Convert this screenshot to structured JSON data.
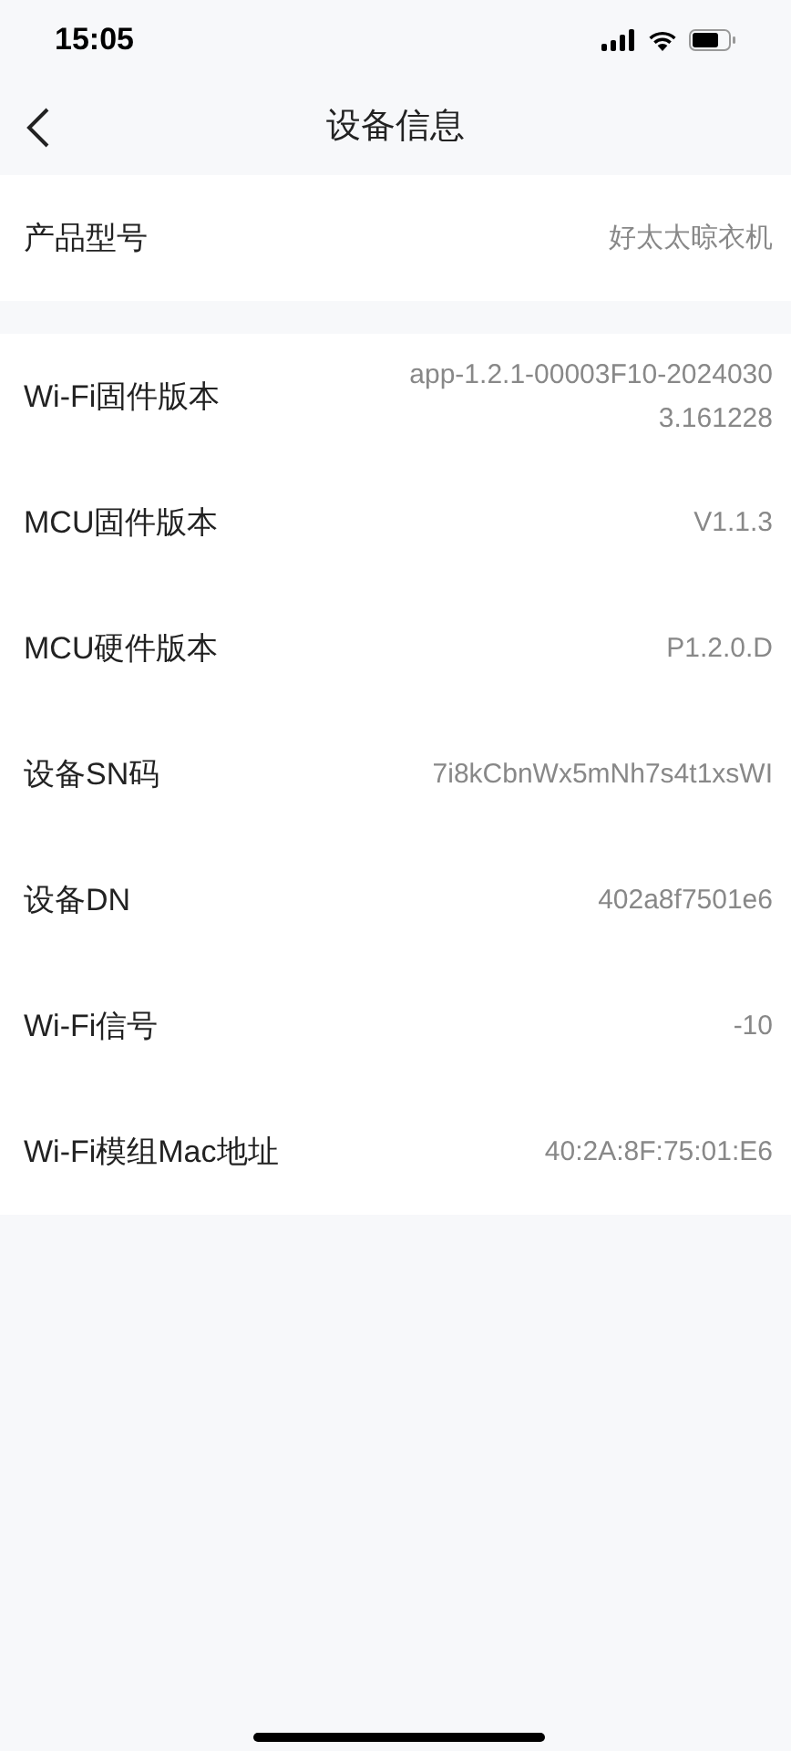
{
  "status_bar": {
    "time": "15:05"
  },
  "nav": {
    "title": "设备信息"
  },
  "groups": [
    {
      "rows": [
        {
          "label": "产品型号",
          "value": "好太太晾衣机"
        }
      ]
    },
    {
      "rows": [
        {
          "label": "Wi-Fi固件版本",
          "value": "app-1.2.1-00003F10-20240303.161228"
        },
        {
          "label": "MCU固件版本",
          "value": "V1.1.3"
        },
        {
          "label": "MCU硬件版本",
          "value": "P1.2.0.D"
        },
        {
          "label": "设备SN码",
          "value": "7i8kCbnWx5mNh7s4t1xsWI"
        },
        {
          "label": "设备DN",
          "value": "402a8f7501e6"
        },
        {
          "label": "Wi-Fi信号",
          "value": "-10"
        },
        {
          "label": "Wi-Fi模组Mac地址",
          "value": "40:2A:8F:75:01:E6"
        }
      ]
    }
  ]
}
